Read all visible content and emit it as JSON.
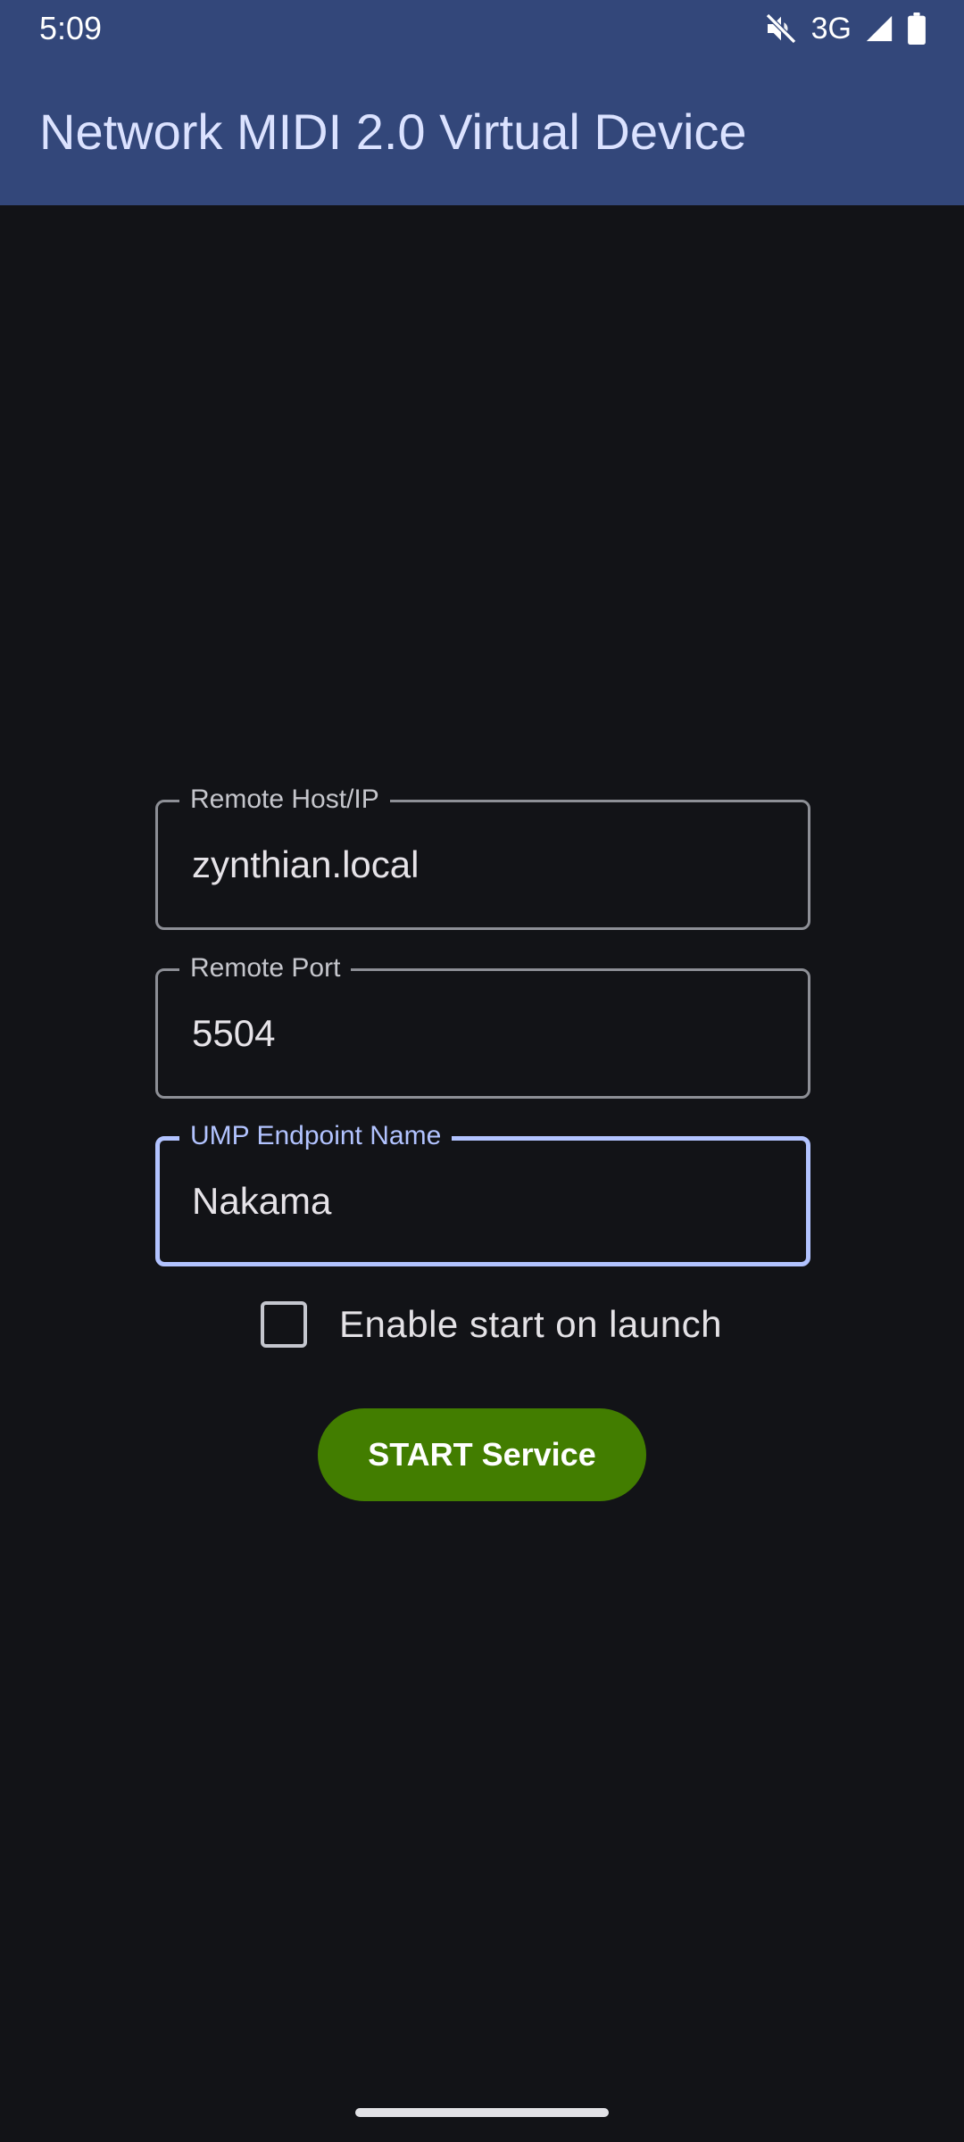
{
  "status_bar": {
    "time": "5:09",
    "network_type": "3G",
    "icons": [
      "mute-icon",
      "signal-icon",
      "battery-icon"
    ]
  },
  "app_bar": {
    "title": "Network MIDI 2.0 Virtual Device",
    "background_color": "#33477a"
  },
  "form": {
    "remote_host": {
      "label": "Remote Host/IP",
      "value": "zynthian.local"
    },
    "remote_port": {
      "label": "Remote Port",
      "value": "5504"
    },
    "endpoint_name": {
      "label": "UMP Endpoint Name",
      "value": "Nakama",
      "focused": true
    },
    "start_on_launch": {
      "label": "Enable start on launch",
      "checked": false
    },
    "start_button": {
      "label": "START Service",
      "color": "#427d00"
    }
  },
  "colors": {
    "background": "#121317",
    "focus_accent": "#b2c3ff"
  }
}
